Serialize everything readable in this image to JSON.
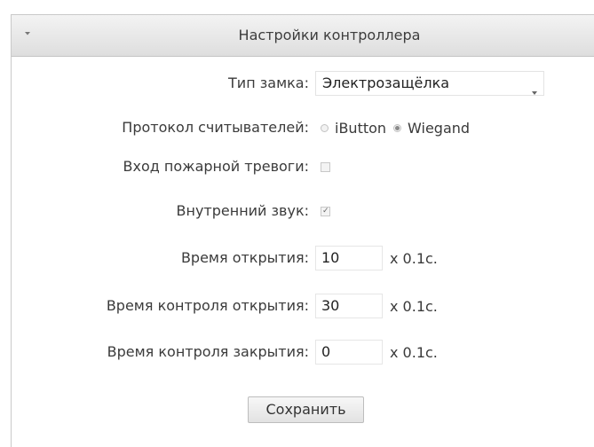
{
  "panel": {
    "title": "Настройки контроллера",
    "toggle_icon": "caret-down-icon"
  },
  "form": {
    "lock_type": {
      "label": "Тип замка:",
      "value": "Электрозащёлка",
      "icon": "chevron-down-icon"
    },
    "reader_protocol": {
      "label": "Протокол считывателей:",
      "options": [
        {
          "label": "iButton",
          "selected": false
        },
        {
          "label": "Wiegand",
          "selected": true
        }
      ]
    },
    "fire_alarm_input": {
      "label": "Вход пожарной тревоги:",
      "checked": false
    },
    "internal_sound": {
      "label": "Внутренний звук:",
      "checked": true
    },
    "open_time": {
      "label": "Время открытия:",
      "value": "10",
      "unit": "x 0.1c."
    },
    "open_control_time": {
      "label": "Время контроля открытия:",
      "value": "30",
      "unit": "x 0.1c."
    },
    "close_control_time": {
      "label": "Время контроля закрытия:",
      "value": "0",
      "unit": "x 0.1c."
    }
  },
  "actions": {
    "save_label": "Сохранить"
  }
}
